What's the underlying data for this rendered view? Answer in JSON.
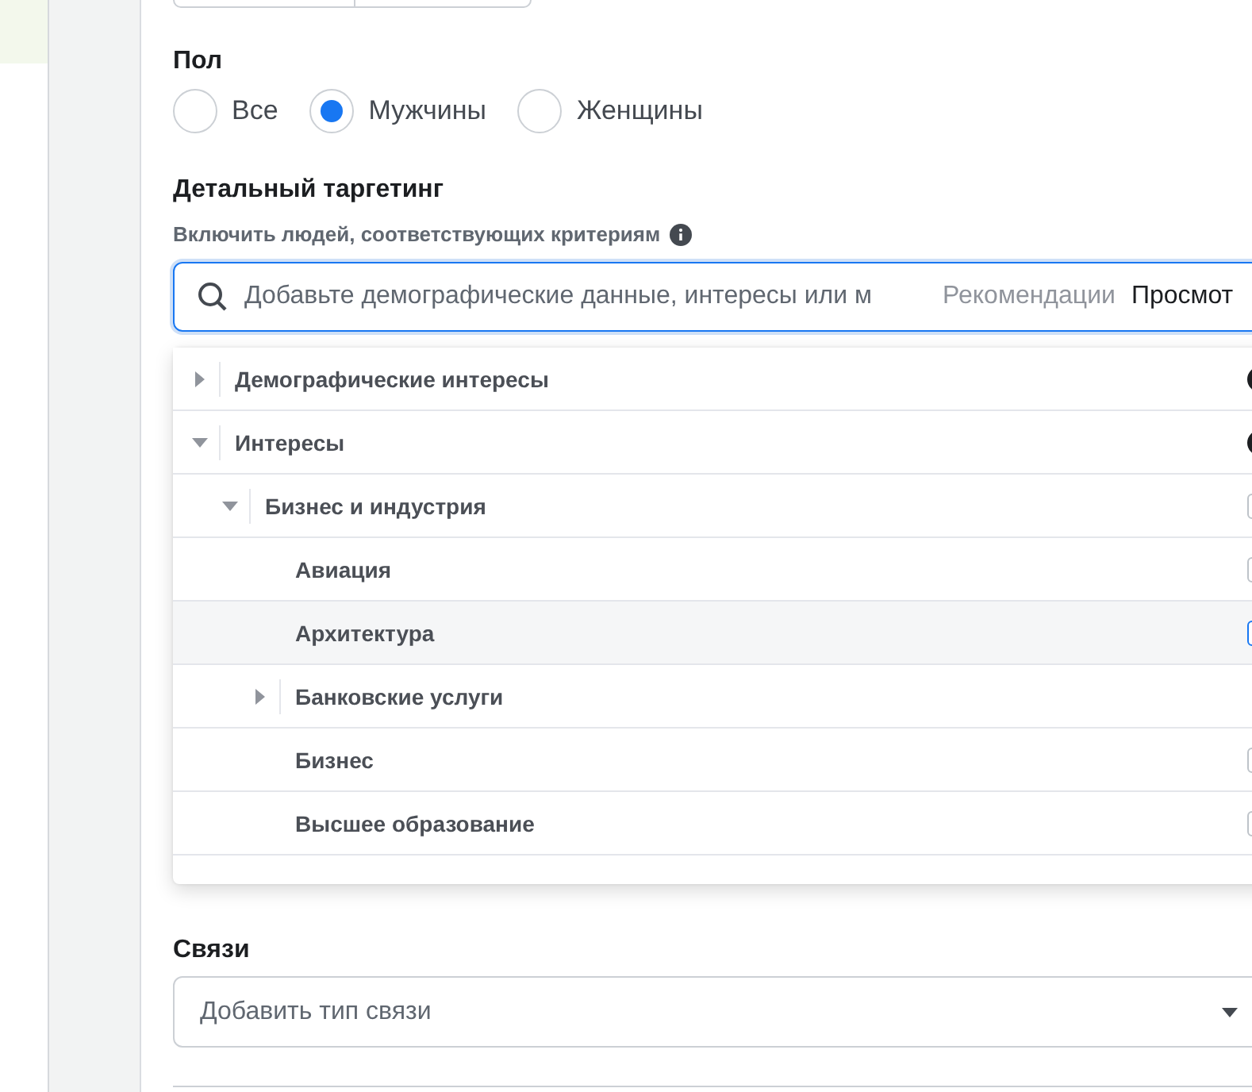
{
  "gender": {
    "title": "Пол",
    "options": [
      {
        "label": "Все",
        "selected": false
      },
      {
        "label": "Мужчины",
        "selected": true
      },
      {
        "label": "Женщины",
        "selected": false
      }
    ]
  },
  "detailed_targeting": {
    "title": "Детальный таргетинг",
    "subtitle": "Включить людей, соответствующих критериям",
    "search": {
      "placeholder": "Добавьте демографические данные, интересы или м",
      "tabs": [
        {
          "label": "Рекомендации",
          "selected": false
        },
        {
          "label": "Просмот",
          "selected": true
        }
      ]
    },
    "tree": [
      {
        "label": "Демографические интересы",
        "expanded": false,
        "kind": "category"
      },
      {
        "label": "Интересы",
        "expanded": true,
        "kind": "category",
        "children": [
          {
            "label": "Бизнес и индустрия",
            "expanded": true,
            "kind": "group",
            "checked": false,
            "highlighted": false,
            "children": [
              {
                "label": "Авиация",
                "kind": "leaf",
                "checked": false,
                "highlighted": false
              },
              {
                "label": "Архитектура",
                "kind": "leaf",
                "checked": false,
                "highlighted": true
              },
              {
                "label": "Банковские услуги",
                "kind": "branch",
                "expanded": false
              },
              {
                "label": "Бизнес",
                "kind": "leaf",
                "checked": false,
                "highlighted": false
              },
              {
                "label": "Высшее образование",
                "kind": "leaf",
                "checked": false,
                "highlighted": false
              }
            ]
          }
        ]
      }
    ]
  },
  "connections": {
    "title": "Связи",
    "placeholder": "Добавить тип связи"
  }
}
